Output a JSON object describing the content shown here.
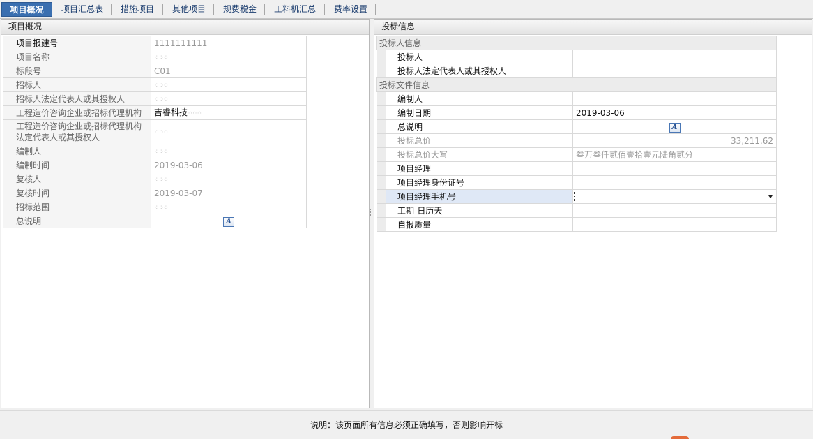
{
  "tabs": [
    {
      "label": "项目概况",
      "active": true
    },
    {
      "label": "项目汇总表",
      "active": false
    },
    {
      "label": "措施项目",
      "active": false
    },
    {
      "label": "其他项目",
      "active": false
    },
    {
      "label": "规费税金",
      "active": false
    },
    {
      "label": "工料机汇总",
      "active": false
    },
    {
      "label": "费率设置",
      "active": false
    }
  ],
  "left_panel": {
    "title": "项目概况",
    "rows": [
      {
        "label": "项目报建号",
        "value": "1111111111"
      },
      {
        "label": "项目名称",
        "value": ""
      },
      {
        "label": "标段号",
        "value": "C01"
      },
      {
        "label": "招标人",
        "value": ""
      },
      {
        "label": "招标人法定代表人或其授权人",
        "value": ""
      },
      {
        "label": "工程造价咨询企业或招标代理机构",
        "value": "吉睿科技"
      },
      {
        "label": "工程造价咨询企业或招标代理机构法定代表人或其授权人",
        "value": ""
      },
      {
        "label": "编制人",
        "value": ""
      },
      {
        "label": "编制时间",
        "value": "2019-03-06"
      },
      {
        "label": "复核人",
        "value": ""
      },
      {
        "label": "复核时间",
        "value": "2019-03-07"
      },
      {
        "label": "招标范围",
        "value": ""
      },
      {
        "label": "总说明",
        "value": ""
      }
    ]
  },
  "right_panel": {
    "title": "投标信息",
    "section1": "投标人信息",
    "rows1": [
      {
        "label": "投标人",
        "value": ""
      },
      {
        "label": "投标人法定代表人或其授权人",
        "value": ""
      }
    ],
    "section2": "投标文件信息",
    "rows2": [
      {
        "label": "编制人",
        "value": ""
      },
      {
        "label": "编制日期",
        "value": "2019-03-06"
      },
      {
        "label": "总说明",
        "value": ""
      },
      {
        "label": "投标总价",
        "value": "33,211.62"
      },
      {
        "label": "投标总价大写",
        "value": "叁万叁仟贰佰壹拾壹元陆角贰分"
      },
      {
        "label": "项目经理",
        "value": ""
      },
      {
        "label": "项目经理身份证号",
        "value": ""
      },
      {
        "label": "项目经理手机号",
        "value": ""
      },
      {
        "label": "工期-日历天",
        "value": ""
      },
      {
        "label": "自报质量",
        "value": ""
      }
    ]
  },
  "icons": {
    "edit": "A"
  },
  "footer": {
    "note": "说明：该页面所有信息必须正确填写，否则影响开标"
  },
  "colors": {
    "tab_active": "#3a6fb0",
    "highlight_row": "#dfe8f6"
  }
}
